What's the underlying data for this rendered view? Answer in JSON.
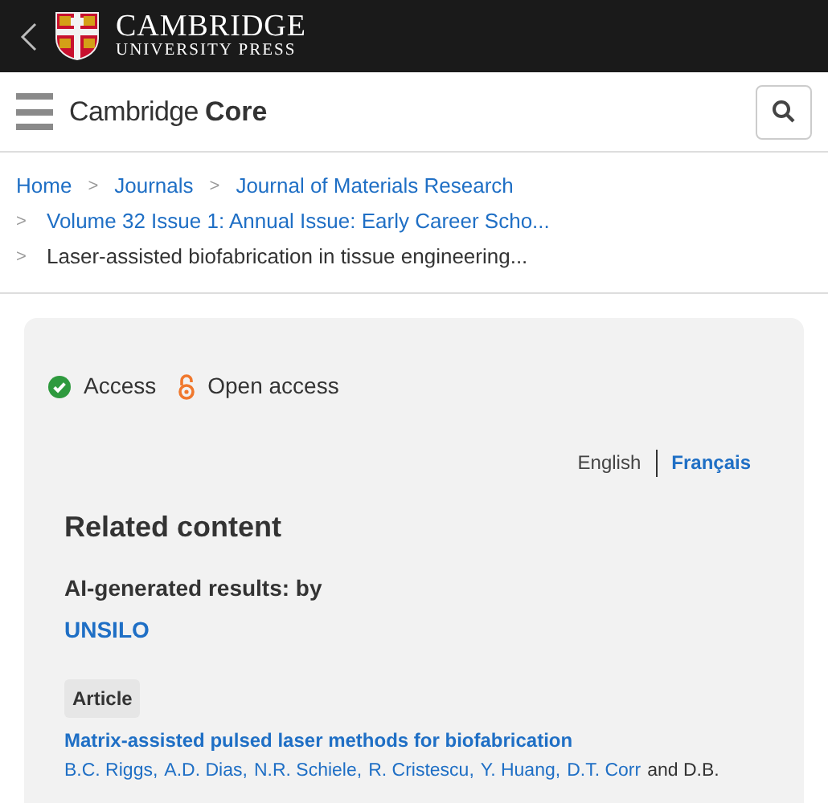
{
  "header": {
    "publisher_line1": "CAMBRIDGE",
    "publisher_line2": "UNIVERSITY PRESS"
  },
  "nav": {
    "brand_light": "Cambridge",
    "brand_bold": "Core"
  },
  "breadcrumbs": [
    {
      "label": "Home",
      "kind": "link"
    },
    {
      "label": "Journals",
      "kind": "link"
    },
    {
      "label": "Journal of Materials Research",
      "kind": "link"
    },
    {
      "label": "Volume 32 Issue 1: Annual Issue: Early Career Scho...",
      "kind": "link"
    },
    {
      "label": "Laser-assisted biofabrication in tissue engineering...",
      "kind": "current"
    }
  ],
  "separator": ">",
  "access": [
    {
      "label": "Access",
      "kind": "check"
    },
    {
      "label": "Open access",
      "kind": "open-lock"
    }
  ],
  "languages": [
    {
      "label": "English",
      "selected": false
    },
    {
      "label": "Français",
      "selected": true
    }
  ],
  "related": {
    "title": "Related content",
    "subtitle": "AI-generated results: by",
    "provider": "UNSILO",
    "items": [
      {
        "type": "Article",
        "title": "Matrix-assisted pulsed laser methods for biofabrication",
        "authors": [
          {
            "text": "B.C. Riggs",
            "kind": "link"
          },
          {
            "text": ",",
            "kind": "sep"
          },
          {
            "text": "A.D. Dias",
            "kind": "link"
          },
          {
            "text": ",",
            "kind": "sep"
          },
          {
            "text": "N.R. Schiele",
            "kind": "link"
          },
          {
            "text": ",",
            "kind": "sep"
          },
          {
            "text": "R. Cristescu",
            "kind": "link"
          },
          {
            "text": ",",
            "kind": "sep"
          },
          {
            "text": "Y. Huang",
            "kind": "link"
          },
          {
            "text": ",",
            "kind": "sep"
          },
          {
            "text": "D.T. Corr",
            "kind": "link"
          },
          {
            "text": "and D.B.",
            "kind": "text"
          }
        ]
      }
    ]
  }
}
